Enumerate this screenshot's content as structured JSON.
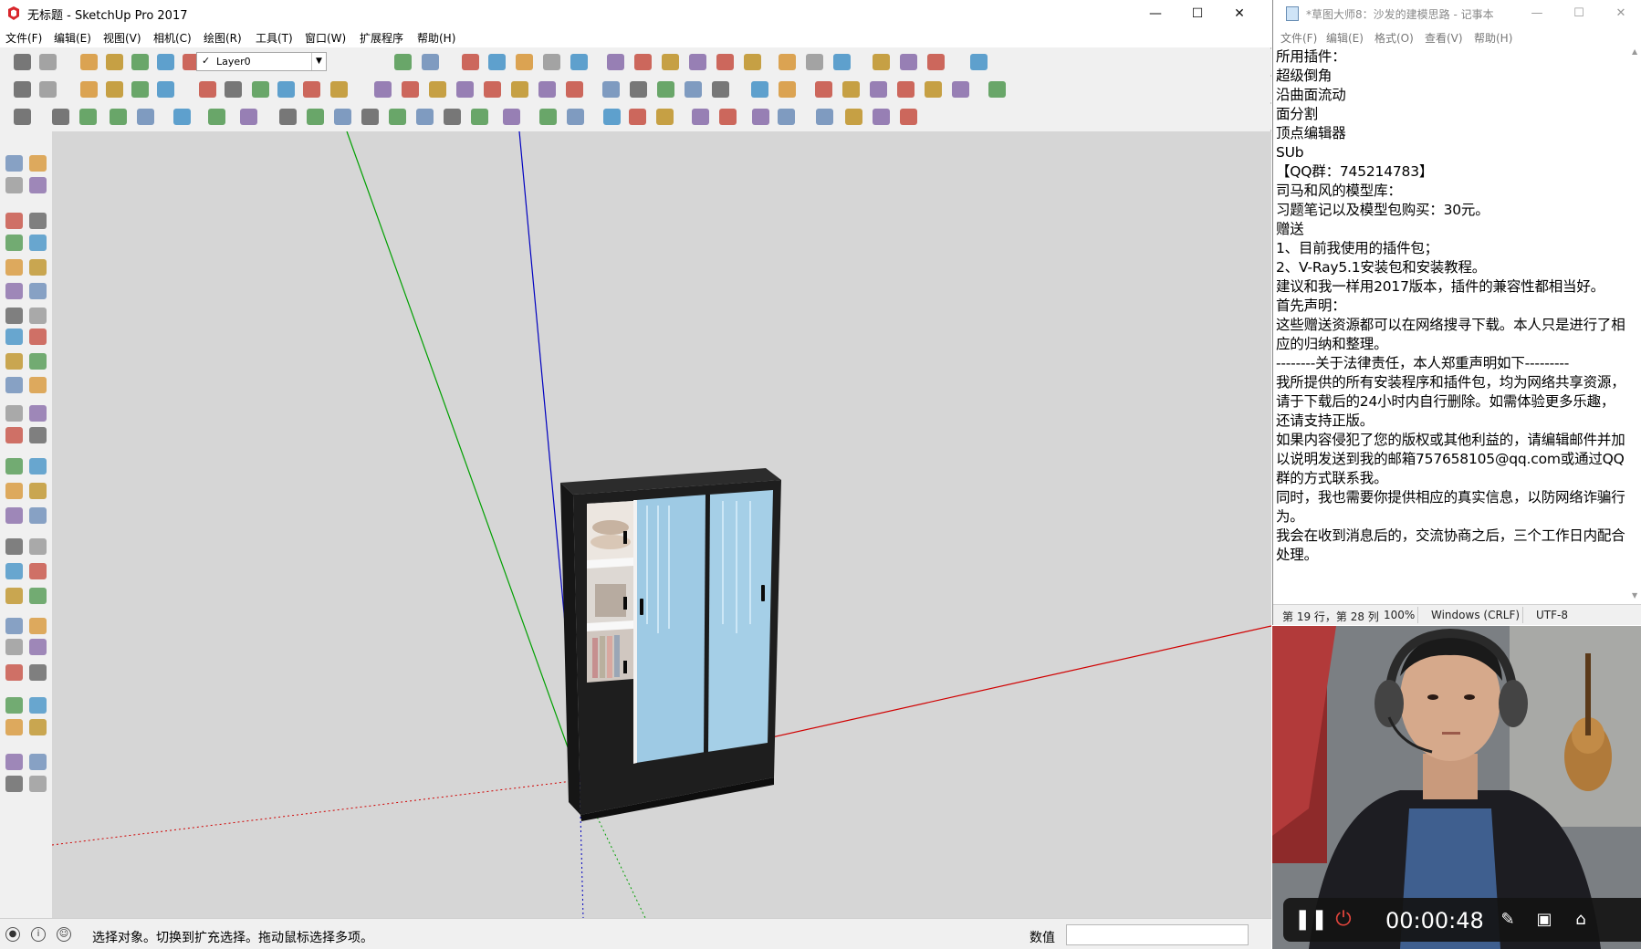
{
  "sketchup": {
    "title": "无标题 - SketchUp Pro 2017",
    "menu": [
      "文件(F)",
      "编辑(E)",
      "视图(V)",
      "相机(C)",
      "绘图(R)",
      "工具(T)",
      "窗口(W)",
      "扩展程序",
      "帮助(H)"
    ],
    "layer": "Layer0",
    "status_text": "选择对象。切换到扩充选择。拖动鼠标选择多项。",
    "measure_label": "数值",
    "colors": {
      "red_axis": "#d00000",
      "green_axis": "#00a000",
      "blue_axis": "#0000c0",
      "viewport_bg": "#d6d6d6"
    }
  },
  "notepad": {
    "title": "*草图大师8：沙发的建模思路 - 记事本",
    "menu": [
      "文件(F)",
      "编辑(E)",
      "格式(O)",
      "查看(V)",
      "帮助(H)"
    ],
    "content": "所用插件：\n超级倒角\n沿曲面流动\n面分割\n顶点编辑器\nSUb\n【QQ群：745214783】\n司马和风的模型库：\n习题笔记以及模型包购买：30元。\n赠送\n1、目前我使用的插件包；\n2、V-Ray5.1安装包和安装教程。\n建议和我一样用2017版本，插件的兼容性都相当好。\n首先声明：\n这些赠送资源都可以在网络搜寻下载。本人只是进行了相应的归纳和整理。\n--------关于法律责任，本人郑重声明如下---------\n我所提供的所有安装程序和插件包，均为网络共享资源，请于下载后的24小时内自行删除。如需体验更多乐趣，还请支持正版。\n如果内容侵犯了您的版权或其他利益的，请编辑邮件并加以说明发送到我的邮箱757658105@qq.com或通过QQ群的方式联系我。\n同时，我也需要你提供相应的真实信息，以防网络诈骗行为。\n我会在收到消息后的，交流协商之后，三个工作日内配合处理。",
    "status": {
      "position": "第 19 行，第 28 列",
      "zoom": "100%",
      "line_ending": "Windows (CRLF)",
      "encoding": "UTF-8"
    }
  },
  "recorder": {
    "time": "00:00:48"
  }
}
